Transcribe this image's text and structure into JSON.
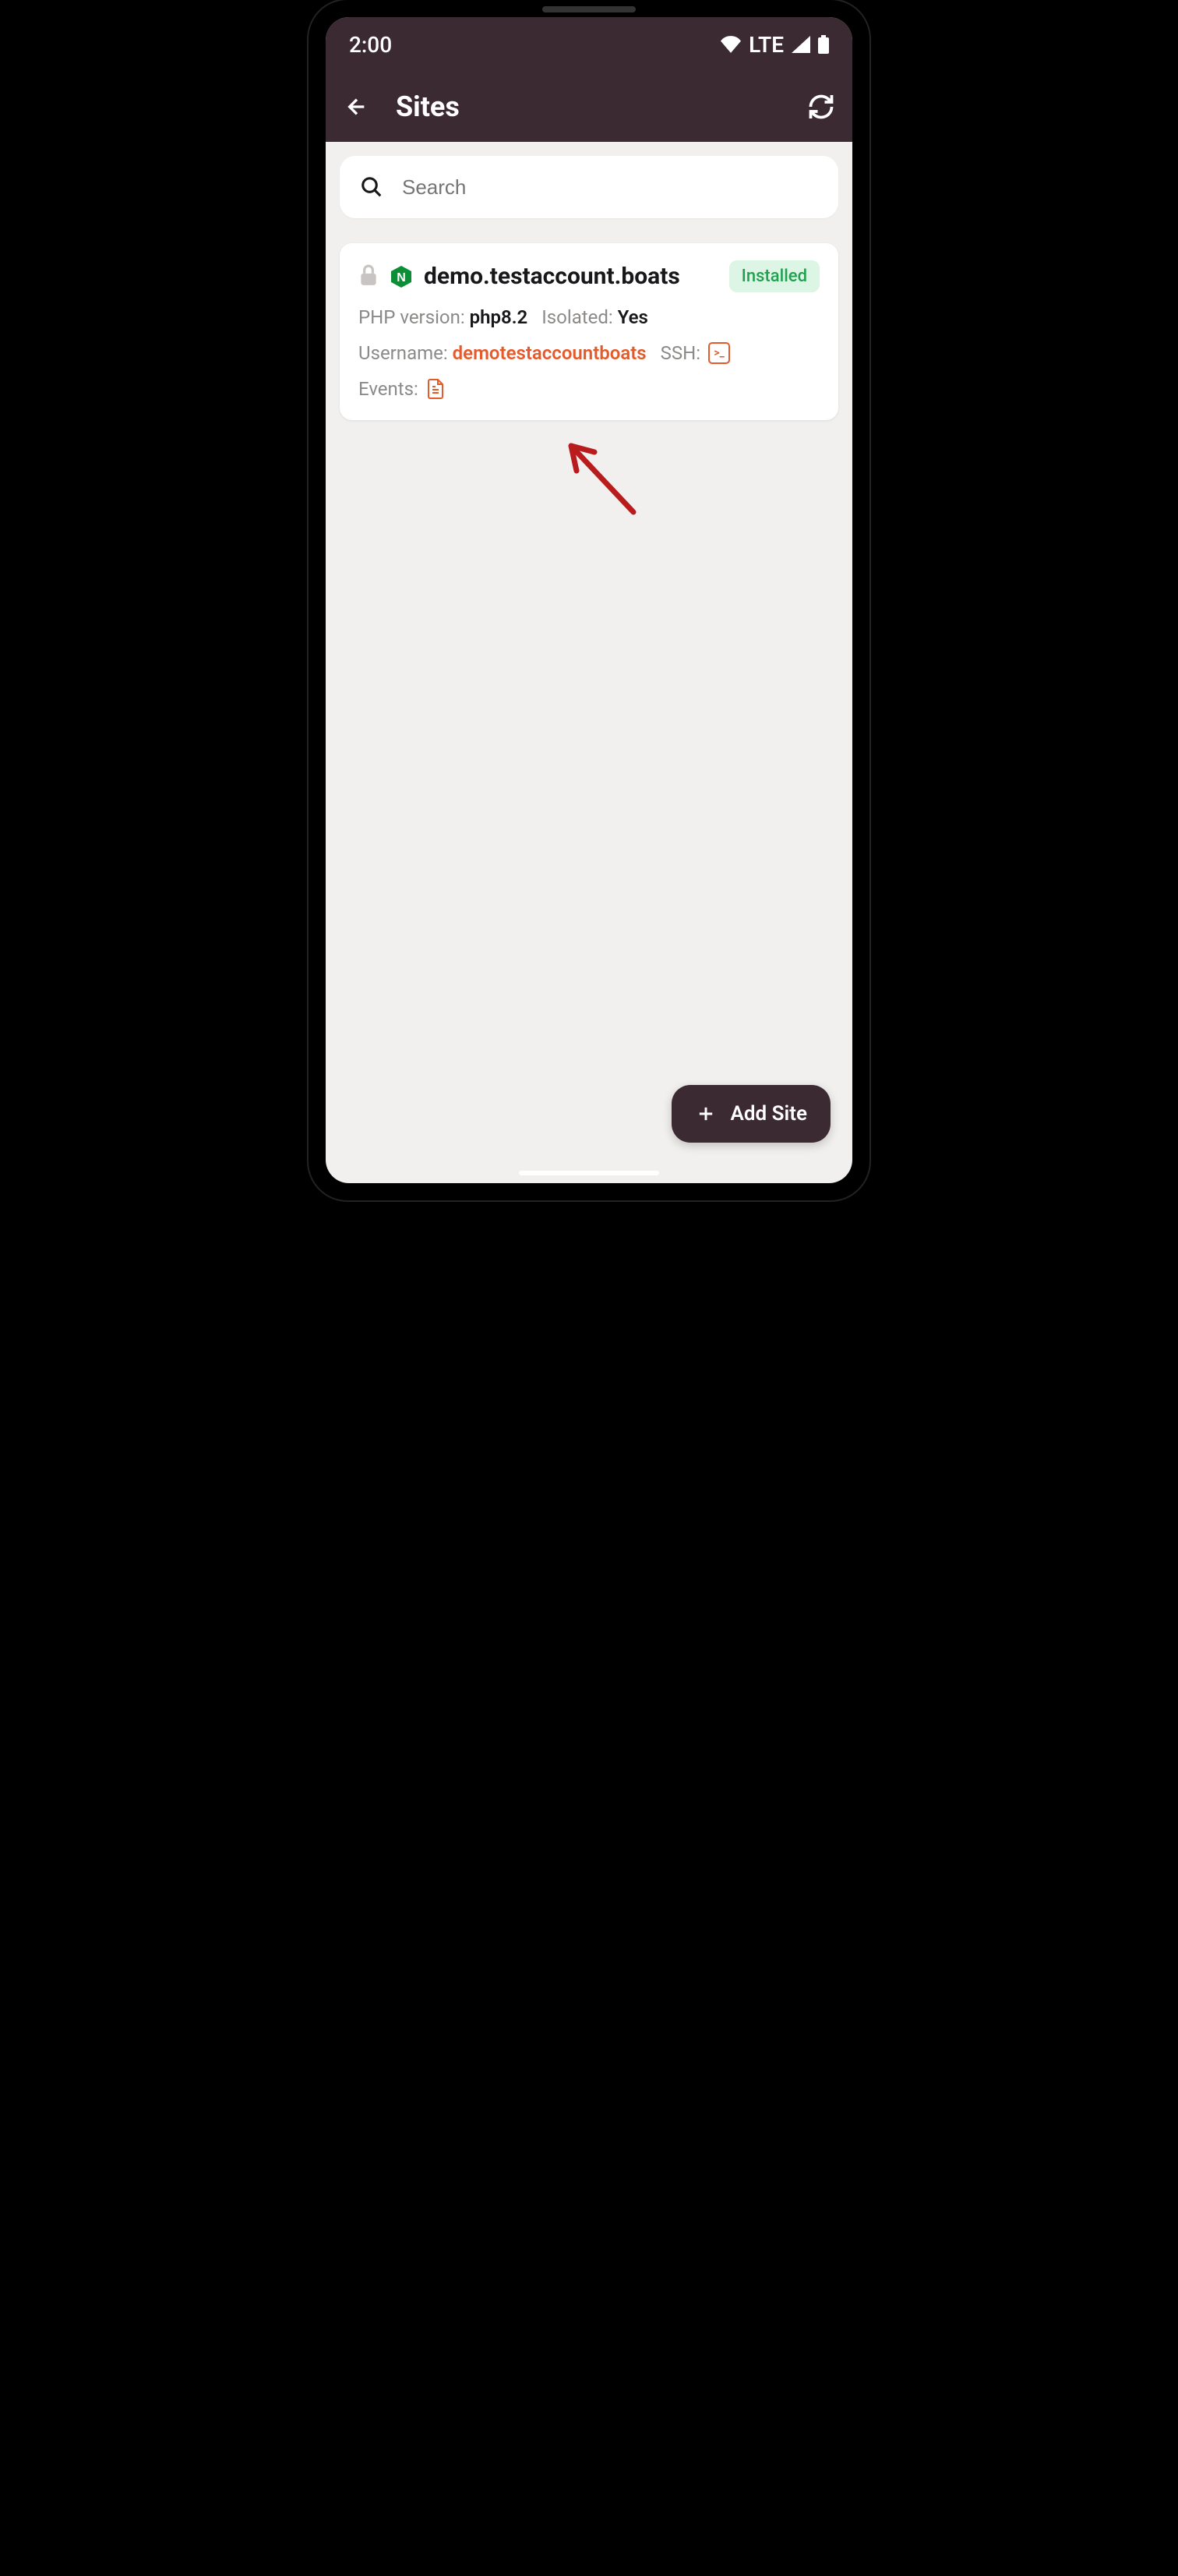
{
  "statusBar": {
    "time": "2:00",
    "network": "LTE"
  },
  "header": {
    "title": "Sites"
  },
  "search": {
    "placeholder": "Search"
  },
  "site": {
    "name": "demo.testaccount.boats",
    "status": "Installed",
    "phpLabel": "PHP version:",
    "phpValue": "php8.2",
    "isolatedLabel": "Isolated:",
    "isolatedValue": "Yes",
    "usernameLabel": "Username:",
    "usernameValue": "demotestaccountboats",
    "sshLabel": "SSH:",
    "eventsLabel": "Events:"
  },
  "fab": {
    "label": "Add Site"
  }
}
